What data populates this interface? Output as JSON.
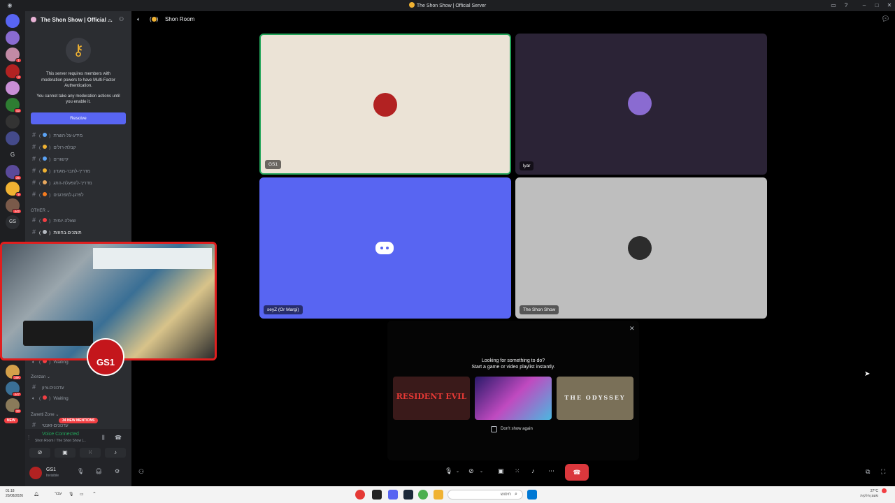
{
  "window": {
    "title": "The Shon Show | Official Server"
  },
  "server": {
    "name": "The Shon Show | Official ..."
  },
  "mfa_notice": {
    "line1": "This server requires members with",
    "line2": "moderation powers to have Multi-Factor",
    "line3": "Authentication.",
    "line4": "You cannot take any moderation actions until",
    "line5": "you enable it.",
    "resolve_label": "Resolve"
  },
  "channels": [
    {
      "name": "מידע-על-השרת",
      "emoji_color": "#5ba3f5"
    },
    {
      "name": "קבלת-רולים",
      "emoji_color": "#f0b232"
    },
    {
      "name": "קישורים",
      "emoji_color": "#5ba3f5"
    },
    {
      "name": "מדריך-לחבר-מועדון",
      "emoji_color": "#f0b232"
    },
    {
      "name": "מדריך-להפעלת-התג",
      "emoji_color": "#e8a85e"
    },
    {
      "name": "לפרגן-למפרגנים",
      "emoji_color": "#f57c1f"
    }
  ],
  "category_other": "OTHER",
  "other_channels": [
    {
      "name": "שאלה-יומית",
      "emoji_color": "#f23f43"
    },
    {
      "name": "תומכים-בחוזות",
      "emoji_color": "#b5bac1"
    }
  ],
  "voice_lower": {
    "waiting1": "Waiting",
    "category_zionzan": "Zionzan",
    "zion_channel": "עדכונים-ציון",
    "waiting2": "Waiting",
    "category_zanetti": "Zanetti Zone",
    "zanetti_channel": "עדכונים-זאנטי",
    "mentions": "34 NEW MENTIONS",
    "new_label": "NEW"
  },
  "user_panel": {
    "voice_connected": "Voice Connected",
    "voice_location": "Shon Room / The Shon Show |...",
    "username": "GS1",
    "status": "Invisible"
  },
  "main": {
    "room_name": "Shon Room"
  },
  "tiles": [
    {
      "label": "GS1",
      "bg": "#ebe3d6"
    },
    {
      "label": "lyar",
      "bg": "#2b2336"
    },
    {
      "label": "seyZ (Or Margi)",
      "bg": "#5865f2"
    },
    {
      "label": "The Shon Show",
      "bg": "#bebebe"
    }
  ],
  "activity": {
    "title": "Looking for something to do?",
    "subtitle": "Start a game or video playlist instantly.",
    "games": [
      {
        "label": "RESIDENT EVIL"
      },
      {
        "label": ""
      },
      {
        "label": "THE ODYSSEY"
      }
    ],
    "dont_show": "Don't show again"
  },
  "taskbar": {
    "time": "01:18",
    "date": "20/08/2026",
    "lang": "עבר",
    "search_placeholder": "חיפוש",
    "weather_temp": "27°C",
    "weather_desc": "מעונן חלקית"
  },
  "guild_badges": [
    "1",
    "4",
    "43",
    "36",
    "9",
    "442",
    "16K",
    "447",
    "33"
  ],
  "guild_letters": [
    "G",
    "GS"
  ],
  "accent": {
    "blurple": "#5865f2",
    "green": "#23a55a",
    "red": "#da373c"
  }
}
